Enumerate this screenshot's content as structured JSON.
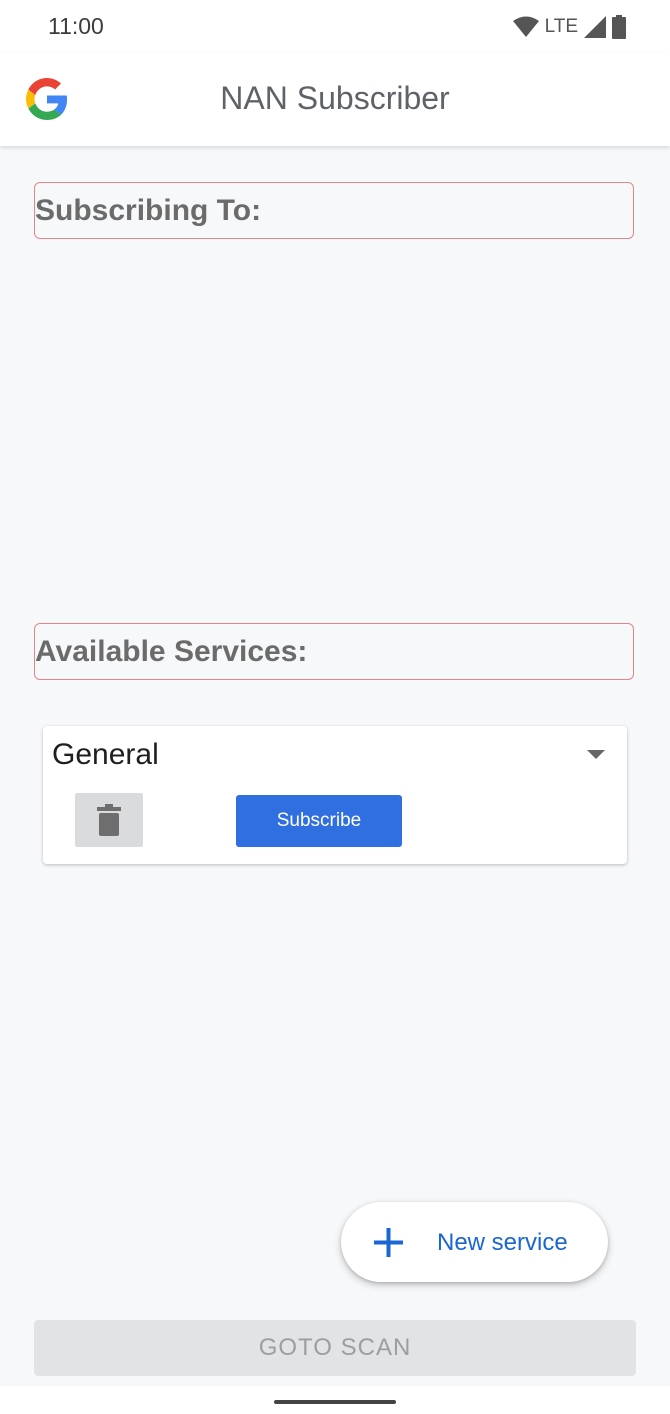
{
  "status_bar": {
    "time": "11:00",
    "network": "LTE",
    "icons": [
      "wifi-icon",
      "signal-icon",
      "battery-icon"
    ]
  },
  "app_bar": {
    "title": "NAN Subscriber",
    "logo": "google-logo-icon"
  },
  "subscribing": {
    "header": "Subscribing To:"
  },
  "available": {
    "header": "Available Services:",
    "service": {
      "selected": "General",
      "subscribe_label": "Subscribe",
      "delete_icon": "trash-icon"
    }
  },
  "fab": {
    "label": "New service",
    "icon": "plus-icon"
  },
  "goto_scan": {
    "label": "GOTO SCAN"
  },
  "colors": {
    "accent": "#2f6fdf",
    "header_border": "#e0868b",
    "background": "#f7f8fa"
  }
}
